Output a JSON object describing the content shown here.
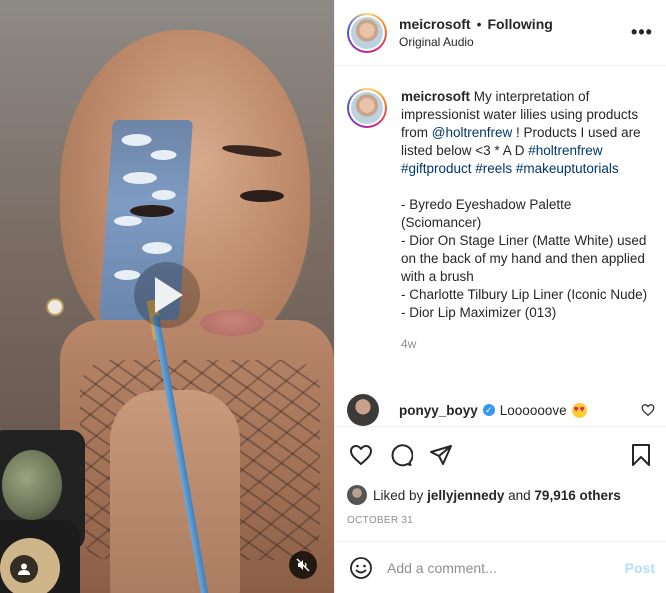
{
  "header": {
    "username": "meicrosoft",
    "separator": "•",
    "follow_status": "Following",
    "audio": "Original Audio",
    "more_label": "•••"
  },
  "caption": {
    "username": "meicrosoft",
    "text_1": "My interpretation of impressionist water lilies using products from ",
    "mention": "@holtrenfrew",
    "text_2": " ! Products I used are listed below <3 * A D ",
    "hashtags": "#holtrenfrew #giftproduct #reels #makeuptutorials",
    "products": [
      "- Byredo Eyeshadow Palette (Sciomancer)",
      "- Dior On Stage Liner (Matte White) used on the back of my hand and then applied with a brush",
      "- Charlotte Tilbury Lip Liner (Iconic Nude)",
      "- Dior Lip Maximizer (013)"
    ],
    "time_ago": "4w"
  },
  "comment": {
    "username": "ponyy_boyy",
    "verified": "✓",
    "text": "Loooooove",
    "emoji": "heart-eyes-emoji"
  },
  "actions": {
    "like_icon": "heart-icon",
    "comment_icon": "comment-icon",
    "share_icon": "share-icon",
    "save_icon": "bookmark-icon"
  },
  "likes": {
    "prefix": "Liked by",
    "liker": "jellyjennedy",
    "and": "and",
    "count": "79,916 others"
  },
  "date": "OCTOBER 31",
  "add_comment": {
    "placeholder": "Add a comment...",
    "post_label": "Post"
  },
  "colors": {
    "link": "#00376b",
    "post_disabled": "#b2dffc",
    "verified": "#3897f0",
    "muted": "#8e8e8e"
  }
}
